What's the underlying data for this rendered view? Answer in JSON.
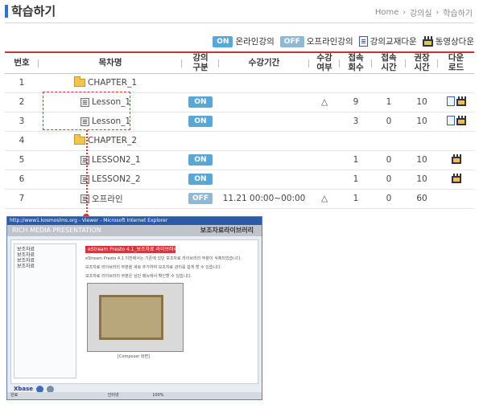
{
  "header": {
    "title": "학습하기",
    "breadcrumb": [
      "Home",
      "강의실",
      "학습하기"
    ]
  },
  "legend": {
    "on_badge": "ON",
    "on_label": "온라인강의",
    "off_badge": "OFF",
    "off_label": "오프라인강의",
    "doc_label": "강의교재다운",
    "video_label": "동영상다운"
  },
  "table": {
    "headers": [
      "번호",
      "목차명",
      "강의\n구분",
      "수강기간",
      "수강\n여부",
      "접속\n회수",
      "접속\n시간",
      "권장\n시간",
      "다운\n로드"
    ],
    "rows": [
      {
        "no": "1",
        "title": "CHAPTER_1",
        "type": "folder",
        "mode": "",
        "period": "",
        "done": "",
        "visits": "",
        "time": "",
        "recommend": "",
        "download": []
      },
      {
        "no": "2",
        "title": "Lesson_1",
        "type": "lesson",
        "mode": "ON",
        "period": "",
        "done": "△",
        "visits": "9",
        "time": "1",
        "recommend": "10",
        "download": [
          "doc",
          "video"
        ]
      },
      {
        "no": "3",
        "title": "Lesson_1",
        "type": "lesson",
        "mode": "ON",
        "period": "",
        "done": "",
        "visits": "3",
        "time": "0",
        "recommend": "10",
        "download": [
          "doc",
          "video"
        ]
      },
      {
        "no": "4",
        "title": "CHAPTER_2",
        "type": "folder",
        "mode": "",
        "period": "",
        "done": "",
        "visits": "",
        "time": "",
        "recommend": "",
        "download": []
      },
      {
        "no": "5",
        "title": "LESSON2_1",
        "type": "lesson",
        "mode": "ON",
        "period": "",
        "done": "",
        "visits": "1",
        "time": "0",
        "recommend": "10",
        "download": [
          "video"
        ]
      },
      {
        "no": "6",
        "title": "LESSON2_2",
        "type": "lesson",
        "mode": "ON",
        "period": "",
        "done": "",
        "visits": "1",
        "time": "0",
        "recommend": "10",
        "download": [
          "video"
        ]
      },
      {
        "no": "7",
        "title": "오프라인",
        "type": "lesson",
        "mode": "OFF",
        "period": "11.21 00:00~00:00",
        "done": "△",
        "visits": "1",
        "time": "0",
        "recommend": "60",
        "download": []
      }
    ]
  },
  "preview": {
    "window_title": "http://www1.kosmoslms.org - Viewer - Microsoft Internet Explorer",
    "brand_band": "RICH MEDIA PRESENTATION",
    "band_right": "보조자료라이브러리",
    "side_items": [
      "보조자료",
      "보조자료",
      "보조자료",
      "보조자료"
    ],
    "red_heading": "eStream Presto 4.1_보조자료 라이브러리",
    "body_lines": [
      "eStream Presto 4.1 이전에서는 기존에 있던 보조자료 라이브러리 부분이 삭제되었습니다.",
      "보조자료 라이브러리 부분을 새로 추가하여 보조자료 관리를 쉽게 할 수 있습니다.",
      "보조자료 라이브러리 부분은 상단 메뉴에서 확인할 수 있습니다."
    ],
    "shot_caption": "[Composer 화면]",
    "logo": "Xbase",
    "status_left": "완료",
    "status_mid": "인터넷",
    "status_zoom": "100%"
  }
}
